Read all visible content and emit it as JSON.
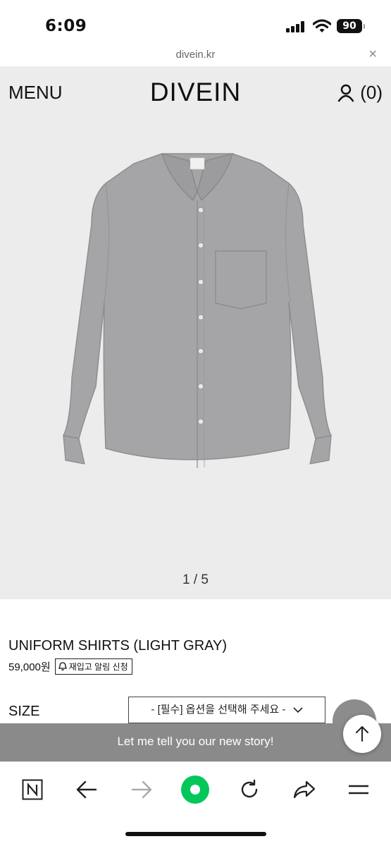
{
  "status_bar": {
    "time": "6:09",
    "battery": "90",
    "icons": [
      "cellular-signal-icon",
      "wifi-icon",
      "battery-icon"
    ]
  },
  "browser": {
    "url": "divein.kr",
    "close_icon": "×"
  },
  "header": {
    "menu_label": "MENU",
    "logo_text": "DIVEIN",
    "cart_count": "(0)"
  },
  "gallery": {
    "pager": "1 / 5",
    "background_color": "#ececec",
    "shirt_color": "#a5a5a7"
  },
  "product": {
    "name": "UNIFORM SHIRTS (LIGHT GRAY)",
    "price": "59,000원",
    "restock_label": "재입고 알림 신청",
    "size_label": "SIZE",
    "size_placeholder": "- [필수] 옵션을 선택해 주세요 -"
  },
  "banner": {
    "text": "Let me tell you our new story!",
    "color": "#8a8a8a"
  },
  "toolbar": {
    "accent_color": "#03c75a",
    "icons": [
      "naver-n-icon",
      "back-arrow-icon",
      "forward-arrow-icon",
      "green-dot-icon",
      "reload-icon",
      "share-icon",
      "menu-lines-icon"
    ]
  }
}
